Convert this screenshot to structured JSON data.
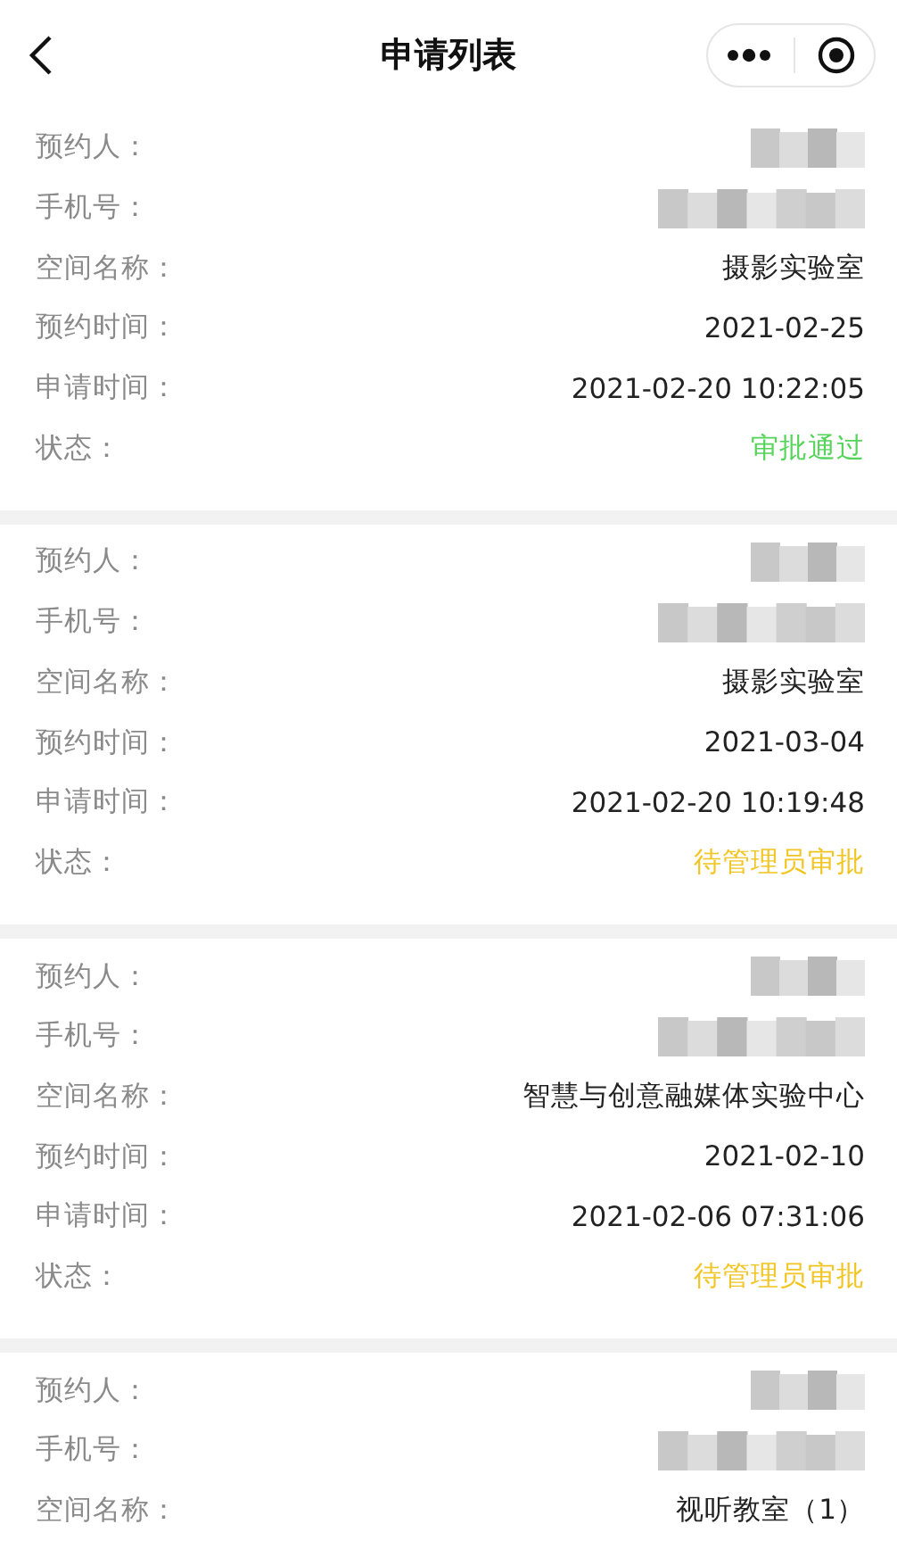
{
  "header": {
    "title": "申请列表"
  },
  "applications": [
    {
      "rows": [
        {
          "kind": "shortmask",
          "label": "预约人："
        },
        {
          "kind": "longmask",
          "label": "手机号："
        },
        {
          "kind": "text",
          "label": "空间名称：",
          "value": "摄影实验室"
        },
        {
          "kind": "text",
          "label": "预约时间：",
          "value": "2021-02-25"
        },
        {
          "kind": "text",
          "label": "申请时间：",
          "value": "2021-02-20 10:22:05"
        },
        {
          "kind": "status",
          "label": "状态：",
          "value": "审批通过",
          "color": "#55d45a"
        }
      ]
    },
    {
      "rows": [
        {
          "kind": "shortmask",
          "label": "预约人："
        },
        {
          "kind": "longmask",
          "label": "手机号："
        },
        {
          "kind": "text",
          "label": "空间名称：",
          "value": "摄影实验室"
        },
        {
          "kind": "text",
          "label": "预约时间：",
          "value": "2021-03-04"
        },
        {
          "kind": "text",
          "label": "申请时间：",
          "value": "2021-02-20 10:19:48"
        },
        {
          "kind": "status",
          "label": "状态：",
          "value": "待管理员审批",
          "color": "#f2c523"
        }
      ]
    },
    {
      "rows": [
        {
          "kind": "shortmask",
          "label": "预约人："
        },
        {
          "kind": "longmask",
          "label": "手机号："
        },
        {
          "kind": "text",
          "label": "空间名称：",
          "value": "智慧与创意融媒体实验中心"
        },
        {
          "kind": "text",
          "label": "预约时间：",
          "value": "2021-02-10"
        },
        {
          "kind": "text",
          "label": "申请时间：",
          "value": "2021-02-06 07:31:06"
        },
        {
          "kind": "status",
          "label": "状态：",
          "value": "待管理员审批",
          "color": "#f2c523"
        }
      ]
    },
    {
      "rows": [
        {
          "kind": "shortmask",
          "label": "预约人："
        },
        {
          "kind": "longmask",
          "label": "手机号："
        },
        {
          "kind": "text",
          "label": "空间名称：",
          "value": "视听教室（1）"
        }
      ]
    }
  ]
}
